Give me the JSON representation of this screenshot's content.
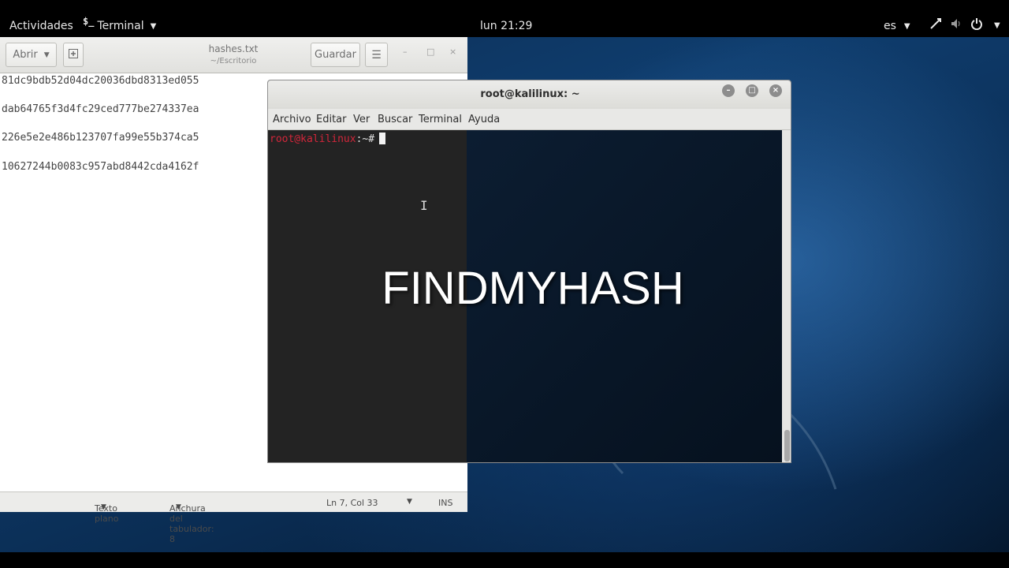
{
  "topbar": {
    "activities": "Actividades",
    "app_icon": "$_",
    "app_name": "Terminal",
    "clock": "lun 21:29",
    "lang": "es"
  },
  "gedit": {
    "open_label": "Abrir",
    "save_label": "Guardar",
    "title": "hashes.txt",
    "subtitle": "~/Escritorio",
    "lines": [
      "81dc9bdb52d04dc20036dbd8313ed055",
      "dab64765f3d4fc29ced777be274337ea",
      "226e5e2e486b123707fa99e55b374ca5",
      "10627244b0083c957abd8442cda4162f"
    ],
    "status": {
      "syntax": "Texto plano",
      "tab_width": "Anchura del tabulador: 8",
      "position": "Ln 7, Col 33",
      "mode": "INS"
    }
  },
  "terminal": {
    "title": "root@kalilinux: ~",
    "menu": [
      "Archivo",
      "Editar",
      "Ver",
      "Buscar",
      "Terminal",
      "Ayuda"
    ],
    "prompt_user": "root@kalilinux",
    "prompt_path": ":~#"
  },
  "overlay": {
    "caption": "FINDMYHASH"
  },
  "icons": {
    "app": "terminal-icon",
    "new_tab": "new-document-icon",
    "menu": "hamburger-menu-icon",
    "minimize": "minimize-icon",
    "maximize": "maximize-icon",
    "close": "close-icon",
    "network": "network-icon",
    "volume": "volume-icon",
    "power": "power-icon"
  },
  "colors": {
    "prompt_user": "#d2263a",
    "desktop_bg": "#0f3d6e"
  }
}
